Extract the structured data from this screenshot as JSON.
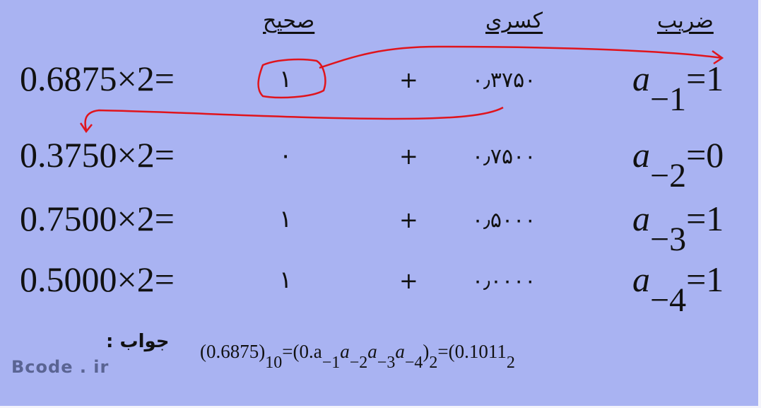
{
  "headers": {
    "multiplier": "ضریب",
    "fractional": "کسری",
    "integer": "صحیح"
  },
  "rows": [
    {
      "expr": "0.6875×2=",
      "int_digit": "۱",
      "plus": "+",
      "fraction": "۰٫۳۷۵۰",
      "coef_letter": "a",
      "coef_sub": "−1",
      "coef_value": "=1"
    },
    {
      "expr": "0.3750×2=",
      "int_digit": "۰",
      "plus": "+",
      "fraction": "۰٫۷۵۰۰",
      "coef_letter": "a",
      "coef_sub": "−2",
      "coef_value": "=0"
    },
    {
      "expr": "0.7500×2=",
      "int_digit": "۱",
      "plus": "+",
      "fraction": "۰٫۵۰۰۰",
      "coef_letter": "a",
      "coef_sub": "−3",
      "coef_value": "=1"
    },
    {
      "expr": "0.5000×2=",
      "int_digit": "۱",
      "plus": "+",
      "fraction": "۰٫۰۰۰۰",
      "coef_letter": "a",
      "coef_sub": "−4",
      "coef_value": "=1"
    }
  ],
  "answer": {
    "label": "جواب :",
    "f1": "(0.6875)",
    "f1_sub": "10",
    "f2": "=(0.a",
    "f2_sub": "−1",
    "f3": "a",
    "f3_sub": "−2",
    "f4": "a",
    "f4_sub": "−3",
    "f5": "a",
    "f5_sub": "−4",
    "f6": ")",
    "f6_sub": "2",
    "f7": "=(0.1011",
    "f7_sub": "2"
  },
  "watermark": "Bcode . ir",
  "colors": {
    "background": "#a9b3f2",
    "annotation": "#e0141c"
  }
}
